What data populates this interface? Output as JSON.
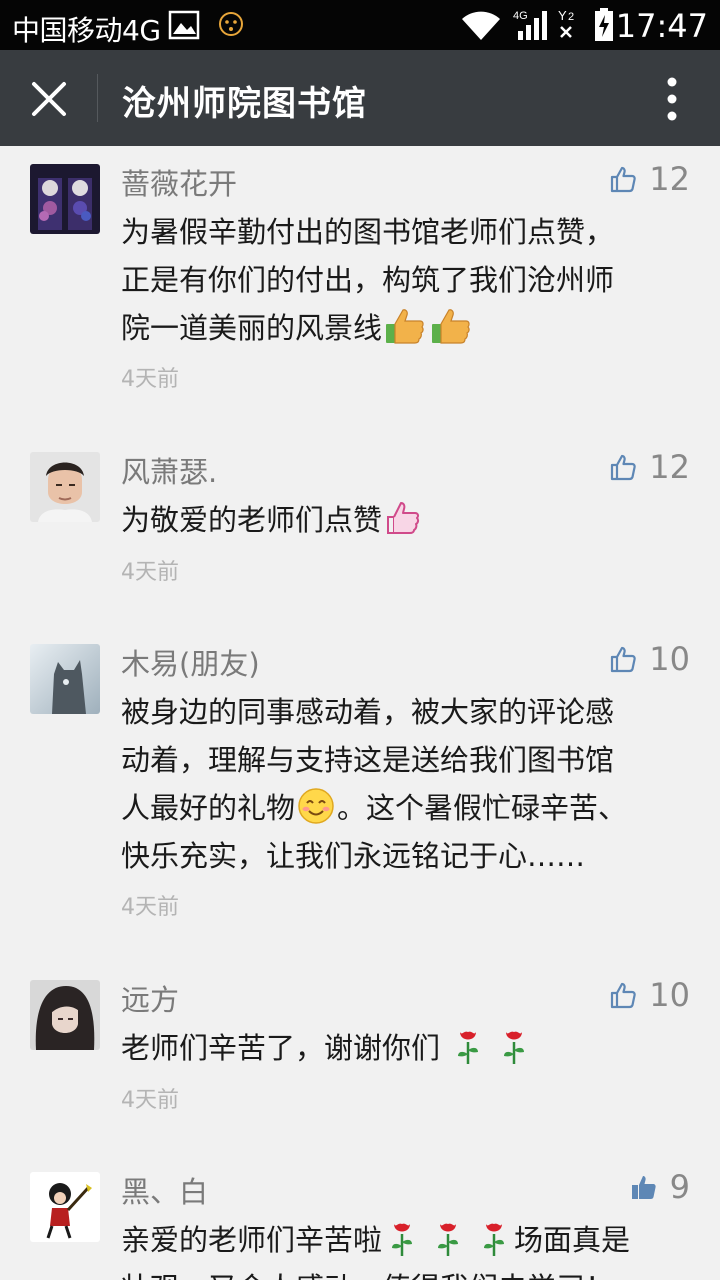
{
  "status_bar": {
    "carrier": "中国移动4G",
    "network_label": "4G",
    "sim_label": "2",
    "time": "17:47"
  },
  "header": {
    "title": "沧州师院图书馆"
  },
  "comments": [
    {
      "name": "蔷薇花开",
      "likes": "12",
      "line1": "为暑假辛勤付出的图书馆老师们点赞，",
      "line2": "正是有你们的付出，构筑了我们沧州师",
      "line3": "院一道美丽的风景线",
      "time": "4天前"
    },
    {
      "name": "风萧瑟.",
      "likes": "12",
      "line1": "为敬爱的老师们点赞",
      "time": "4天前"
    },
    {
      "name": "木易(朋友)",
      "likes": "10",
      "line1": "被身边的同事感动着，被大家的评论感",
      "line2": "动着，理解与支持这是送给我们图书馆",
      "line3a": "人最好的礼物",
      "line3b": "。这个暑假忙碌辛苦、",
      "line4": "快乐充实，让我们永远铭记于心……",
      "time": "4天前"
    },
    {
      "name": "远方",
      "likes": "10",
      "line1": "老师们辛苦了，谢谢你们",
      "time": "4天前"
    },
    {
      "name": "黑、白",
      "likes": "9",
      "line1a": "亲爱的老师们辛苦啦",
      "line1b": "场面真是",
      "line2": "壮观，又令人感动，值得我们去学习！"
    }
  ],
  "colors": {
    "title_bar": "#383c40",
    "status_bar": "#050505",
    "background": "#f1f1f1",
    "like_icon": "#5e87b5"
  }
}
